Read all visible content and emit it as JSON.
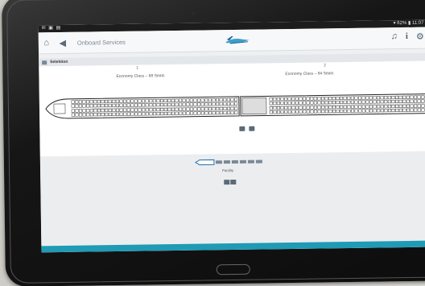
{
  "status": {
    "left": "✉ ▣ ▤",
    "battery": "62%",
    "time": "11:07"
  },
  "appbar": {
    "title": "Onboard Services",
    "home_icon": "home-icon",
    "back_icon": "back-icon",
    "music_icon": "music-icon",
    "info_icon": "info-icon",
    "settings_icon": "settings-icon"
  },
  "section": {
    "label": "Selektion"
  },
  "cars": [
    {
      "number": "1",
      "title": "Economy Class – 68 Seats"
    },
    {
      "number": "2",
      "title": "Economy Class – 84 Seats"
    }
  ],
  "facility": {
    "label": "Facility"
  },
  "colors": {
    "accent": "#1f9bb5",
    "train_outline": "#222222",
    "icon": "#5d6a78"
  }
}
